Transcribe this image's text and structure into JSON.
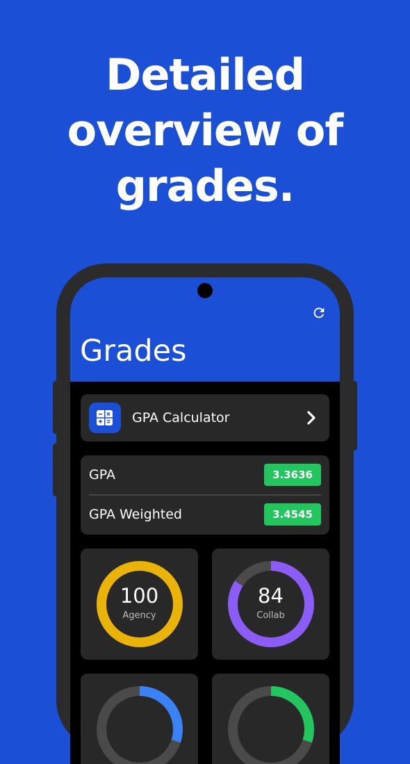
{
  "headline": {
    "line1": "Detailed",
    "line2": "overview of",
    "line3": "grades."
  },
  "app": {
    "title": "Grades",
    "calculator_label": "GPA Calculator",
    "gpa": [
      {
        "label": "GPA",
        "value": "3.3636"
      },
      {
        "label": "GPA Weighted",
        "value": "3.4545"
      }
    ],
    "stats": [
      {
        "value": "100",
        "label": "Agency",
        "percent": 1.0,
        "color": "#eab308"
      },
      {
        "value": "84",
        "label": "Collab",
        "percent": 0.84,
        "color": "#8b5cf6"
      },
      {
        "value": "",
        "label": "",
        "percent": 0.3,
        "color": "#3b82f6"
      },
      {
        "value": "",
        "label": "",
        "percent": 0.3,
        "color": "#22c55e"
      }
    ]
  },
  "colors": {
    "background": "#1b4fd6",
    "app_bar": "#1b4fd6",
    "card": "#282828",
    "badge": "#22c55e",
    "ring_track": "#4a4a4a"
  },
  "icons": {
    "refresh": "refresh-icon",
    "calculator": "calculator-icon",
    "chevron": "chevron-right-icon"
  }
}
